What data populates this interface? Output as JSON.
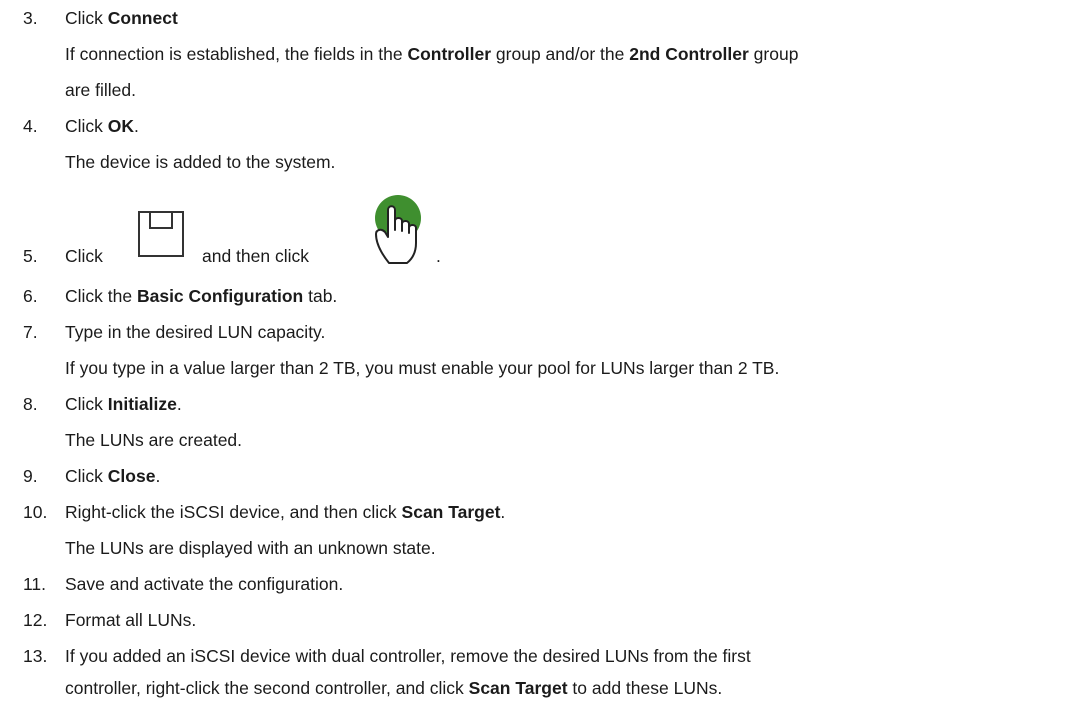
{
  "steps": [
    {
      "num": "3.",
      "a": "Click ",
      "b": "Connect",
      "note": {
        "p1": "If connection is established, the fields in the ",
        "b1": "Controller",
        "p2": " group and/or the ",
        "b2": "2nd Controller",
        "p3": " group",
        "cont": "are filled."
      }
    },
    {
      "num": "4.",
      "a": "Click ",
      "b": "OK",
      "c": ".",
      "note": "The device is added to the system."
    },
    {
      "num": "5.",
      "a": "Click",
      "mid": "and then click",
      "end": ".",
      "icons": [
        "save-icon",
        "hand-pointer-icon"
      ]
    },
    {
      "num": "6.",
      "a": "Click the ",
      "b": "Basic Configuration",
      "c": " tab."
    },
    {
      "num": "7.",
      "a": "Type in the desired LUN capacity.",
      "note": "If you type in a value larger than 2 TB, you must enable your pool for LUNs larger than 2 TB."
    },
    {
      "num": "8.",
      "a": "Click ",
      "b": "Initialize",
      "c": ".",
      "note": "The LUNs are created."
    },
    {
      "num": "9.",
      "a": "Click ",
      "b": "Close",
      "c": "."
    },
    {
      "num": "10.",
      "a": "Right-click the iSCSI device, and then click ",
      "b": "Scan Target",
      "c": ".",
      "note": "The LUNs are displayed with an unknown state."
    },
    {
      "num": "11.",
      "a": "Save and activate the configuration."
    },
    {
      "num": "12.",
      "a": "Format all LUNs."
    },
    {
      "num": "13.",
      "a": "If you added an iSCSI device with dual controller, remove the desired LUNs from the first",
      "cont_a": "controller, right-click the second controller, and click ",
      "cont_b": "Scan Target",
      "cont_c": " to add these LUNs."
    }
  ],
  "colors": {
    "text": "#1b1b1b",
    "hand_green": "#3f8f2f",
    "icon_stroke": "#333333"
  }
}
